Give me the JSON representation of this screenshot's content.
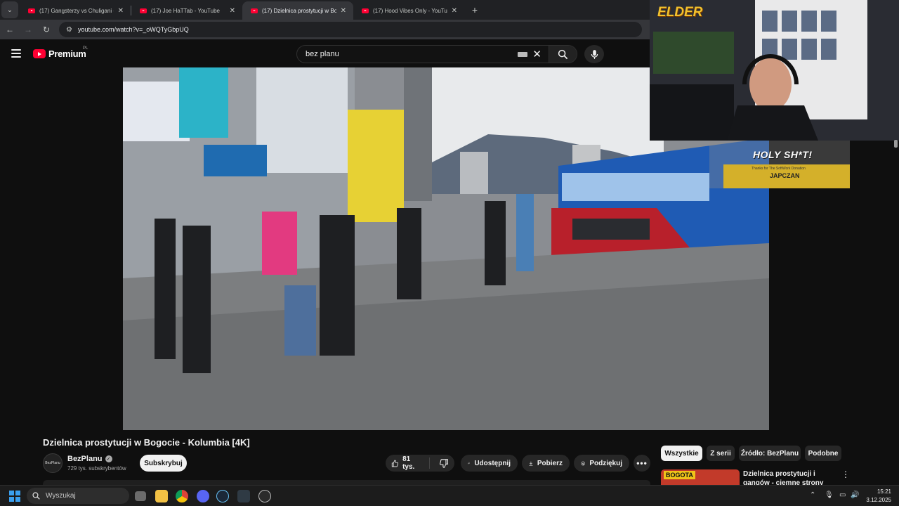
{
  "browser": {
    "tabs": [
      {
        "title": "(17) Gangsterzy vs Chuligani - ..."
      },
      {
        "title": "(17) Joe HaTTab - YouTube"
      },
      {
        "title": "(17) Dzielnica prostytucji w Bog..."
      },
      {
        "title": "(17) Hood Vibes Only - YouTub..."
      }
    ],
    "url": "youtube.com/watch?v=_oWQTyGbpUQ"
  },
  "yt": {
    "logo_text": "Premium",
    "region": "PL",
    "search_value": "bez planu"
  },
  "video": {
    "title": "Dzielnica prostytucji w Bogocie - Kolumbia [4K]",
    "channel": "BezPlanu",
    "channel_avatar_text": "BezPlanu",
    "subscribers": "729 tys. subskrybentów",
    "subscribe_label": "Subskrybuj",
    "likes": "81 tys.",
    "share_label": "Udostępnij",
    "download_label": "Pobierz",
    "thanks_label": "Podziękuj"
  },
  "chips": [
    "Wszystkie",
    "Z serii",
    "Źródło: BezPlanu",
    "Podobne"
  ],
  "recommendation": {
    "thumb_tag": "BOGOTA",
    "title": "Dzielnica prostytucji i gangów - ciemne strony Bogoty"
  },
  "overlay": {
    "streamer_logo": "ELDER",
    "alert_title": "HOLY SH*T!",
    "alert_small": "Thanks for The SoftWork Donation",
    "alert_user": "JAPCZAN"
  },
  "taskbar": {
    "search_placeholder": "Wyszukaj",
    "time": "15:21",
    "date": "3.12.2025"
  }
}
